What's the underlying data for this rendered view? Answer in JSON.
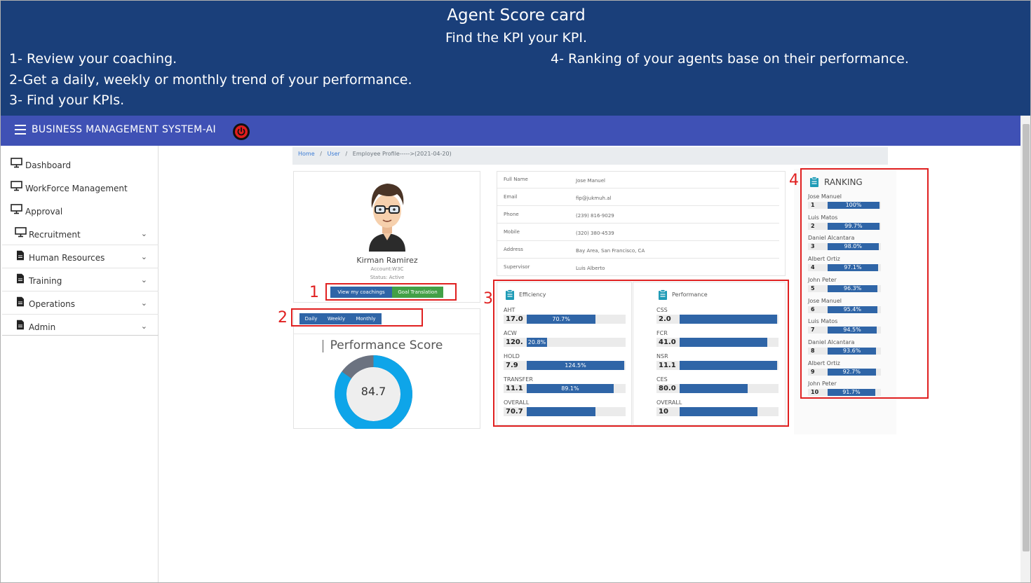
{
  "banner": {
    "title": "Agent Score card",
    "subtitle": "Find the KPI your KPI.",
    "points": [
      "1- Review your coaching.",
      "2-Get a daily, weekly or monthly trend of your performance.",
      "3- Find your KPIs.",
      "4- Ranking of your agents base on their performance."
    ]
  },
  "navbar": {
    "brand": "BUSINESS MANAGEMENT SYSTEM-AI",
    "menu_icon": "menu-icon",
    "power_icon": "power-icon"
  },
  "sidebar": {
    "items": [
      {
        "label": "Dashboard",
        "icon": "monitor-icon"
      },
      {
        "label": "WorkForce Management",
        "icon": "monitor-icon"
      },
      {
        "label": "Approval",
        "icon": "monitor-icon"
      },
      {
        "label": "Recruitment",
        "icon": "monitor-icon"
      },
      {
        "label": "Human Resources",
        "icon": "document-icon"
      },
      {
        "label": "Training",
        "icon": "document-icon"
      },
      {
        "label": "Operations",
        "icon": "document-icon"
      },
      {
        "label": "Admin",
        "icon": "document-icon"
      }
    ]
  },
  "breadcrumb": {
    "home": "Home",
    "user": "User",
    "current": "Employee Profile----->(2021-04-20)"
  },
  "profile": {
    "name": "Kirman Ramirez",
    "account": "Account:W3C",
    "status": "Status: Active",
    "coachings_button": "View my coachings",
    "goal_button": "Goal Translation"
  },
  "trend": {
    "tabs": [
      "Daily",
      "Weekly",
      "Monthly"
    ],
    "title": "Performance Score",
    "score": "84.7"
  },
  "info": {
    "rows": [
      {
        "key": "Full Name",
        "value": "Jose Manuel"
      },
      {
        "key": "Email",
        "value": "fip@jukmuh.al"
      },
      {
        "key": "Phone",
        "value": "(239) 816-9029"
      },
      {
        "key": "Mobile",
        "value": "(320) 380-4539"
      },
      {
        "key": "Address",
        "value": "Bay Area, San Francisco, CA"
      },
      {
        "key": "Supervisor",
        "value": "Luis Alberto"
      }
    ]
  },
  "efficiency": {
    "title": "Efficiency",
    "metrics": [
      {
        "label": "AHT",
        "value": "17.0",
        "bar_text": "70.7%",
        "fill": 0.707
      },
      {
        "label": "ACW",
        "value": "120.",
        "bar_text": "20.8%",
        "fill": 0.208
      },
      {
        "label": "HOLD",
        "value": "7.9",
        "bar_text": "124.5%",
        "fill": 1.0
      },
      {
        "label": "TRANSFER",
        "value": "11.1",
        "bar_text": "89.1%",
        "fill": 0.891
      },
      {
        "label": "OVERALL",
        "value": "70.7",
        "bar_text": "",
        "fill": 0.707
      }
    ]
  },
  "performance": {
    "title": "Performance",
    "metrics": [
      {
        "label": "CSS",
        "value": "2.0",
        "bar_text": "",
        "fill": 1.0
      },
      {
        "label": "FCR",
        "value": "41.0",
        "bar_text": "",
        "fill": 0.9
      },
      {
        "label": "NSR",
        "value": "11.1",
        "bar_text": "",
        "fill": 1.0
      },
      {
        "label": "CES",
        "value": "80.0",
        "bar_text": "",
        "fill": 0.7
      },
      {
        "label": "OVERALL",
        "value": "10",
        "bar_text": "",
        "fill": 0.8
      }
    ]
  },
  "ranking": {
    "title": "RANKING",
    "entries": [
      {
        "name": "Jose Manuel",
        "rank": "1",
        "pct": "100%",
        "fill": 1.0
      },
      {
        "name": "Luis Matos",
        "rank": "2",
        "pct": "99.7%",
        "fill": 0.997
      },
      {
        "name": "Daniel Alcantara",
        "rank": "3",
        "pct": "98.0%",
        "fill": 0.98
      },
      {
        "name": "Albert Ortiz",
        "rank": "4",
        "pct": "97.1%",
        "fill": 0.971
      },
      {
        "name": "John Peter",
        "rank": "5",
        "pct": "96.3%",
        "fill": 0.963
      },
      {
        "name": "Jose Manuel",
        "rank": "6",
        "pct": "95.4%",
        "fill": 0.954
      },
      {
        "name": "Luis Matos",
        "rank": "7",
        "pct": "94.5%",
        "fill": 0.945
      },
      {
        "name": "Daniel Alcantara",
        "rank": "8",
        "pct": "93.6%",
        "fill": 0.936
      },
      {
        "name": "Albert Ortiz",
        "rank": "9",
        "pct": "92.7%",
        "fill": 0.927
      },
      {
        "name": "John Peter",
        "rank": "10",
        "pct": "91.7%",
        "fill": 0.917
      }
    ]
  },
  "annotations": [
    "1",
    "2",
    "3",
    "4"
  ],
  "colors": {
    "banner": "#1a3f7a",
    "navbar": "#3f51b5",
    "bar": "#2f65a7",
    "green": "#43a047",
    "gauge": "#0ea5e9",
    "annotation": "#e02020"
  }
}
